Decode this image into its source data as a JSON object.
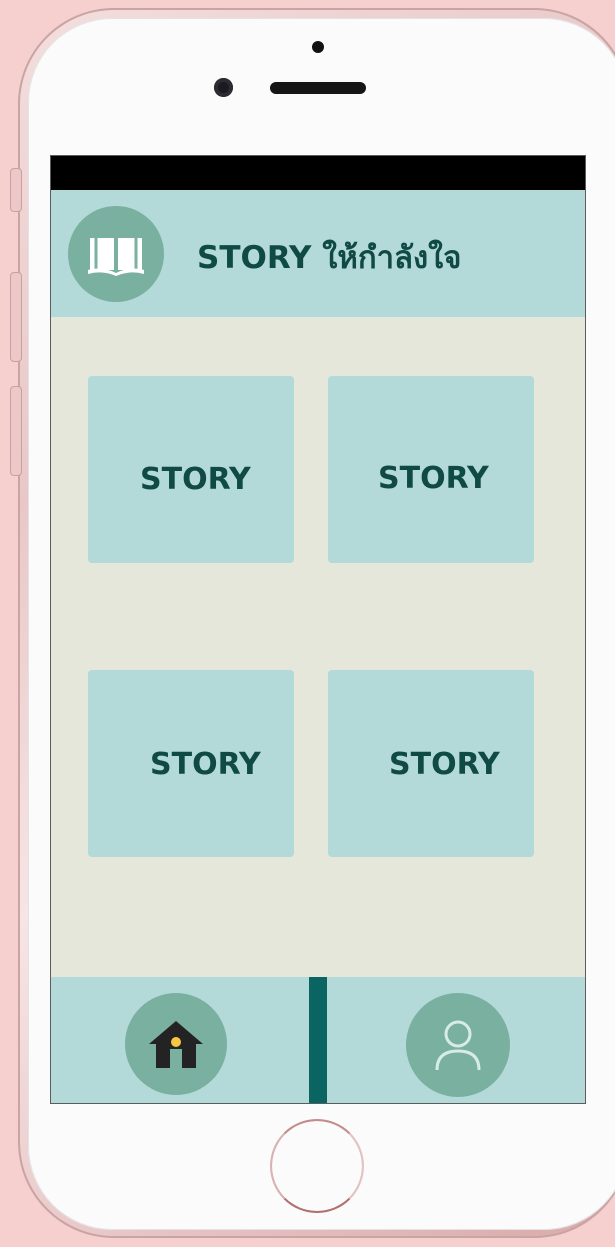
{
  "app": {
    "title": "STORY ให้กำลังใจ",
    "logo_icon": "open-book-icon"
  },
  "cards": [
    {
      "label": "STORY"
    },
    {
      "label": "STORY"
    },
    {
      "label": "STORY"
    },
    {
      "label": "STORY"
    }
  ],
  "nav": {
    "home_icon": "home-icon",
    "profile_icon": "user-icon"
  },
  "colors": {
    "header_bg": "#b3d9d9",
    "content_bg": "#e6e7db",
    "logo_bg": "#79b09f",
    "text": "#0f4a45",
    "divider": "#0a6562",
    "status_bar": "#000000"
  }
}
